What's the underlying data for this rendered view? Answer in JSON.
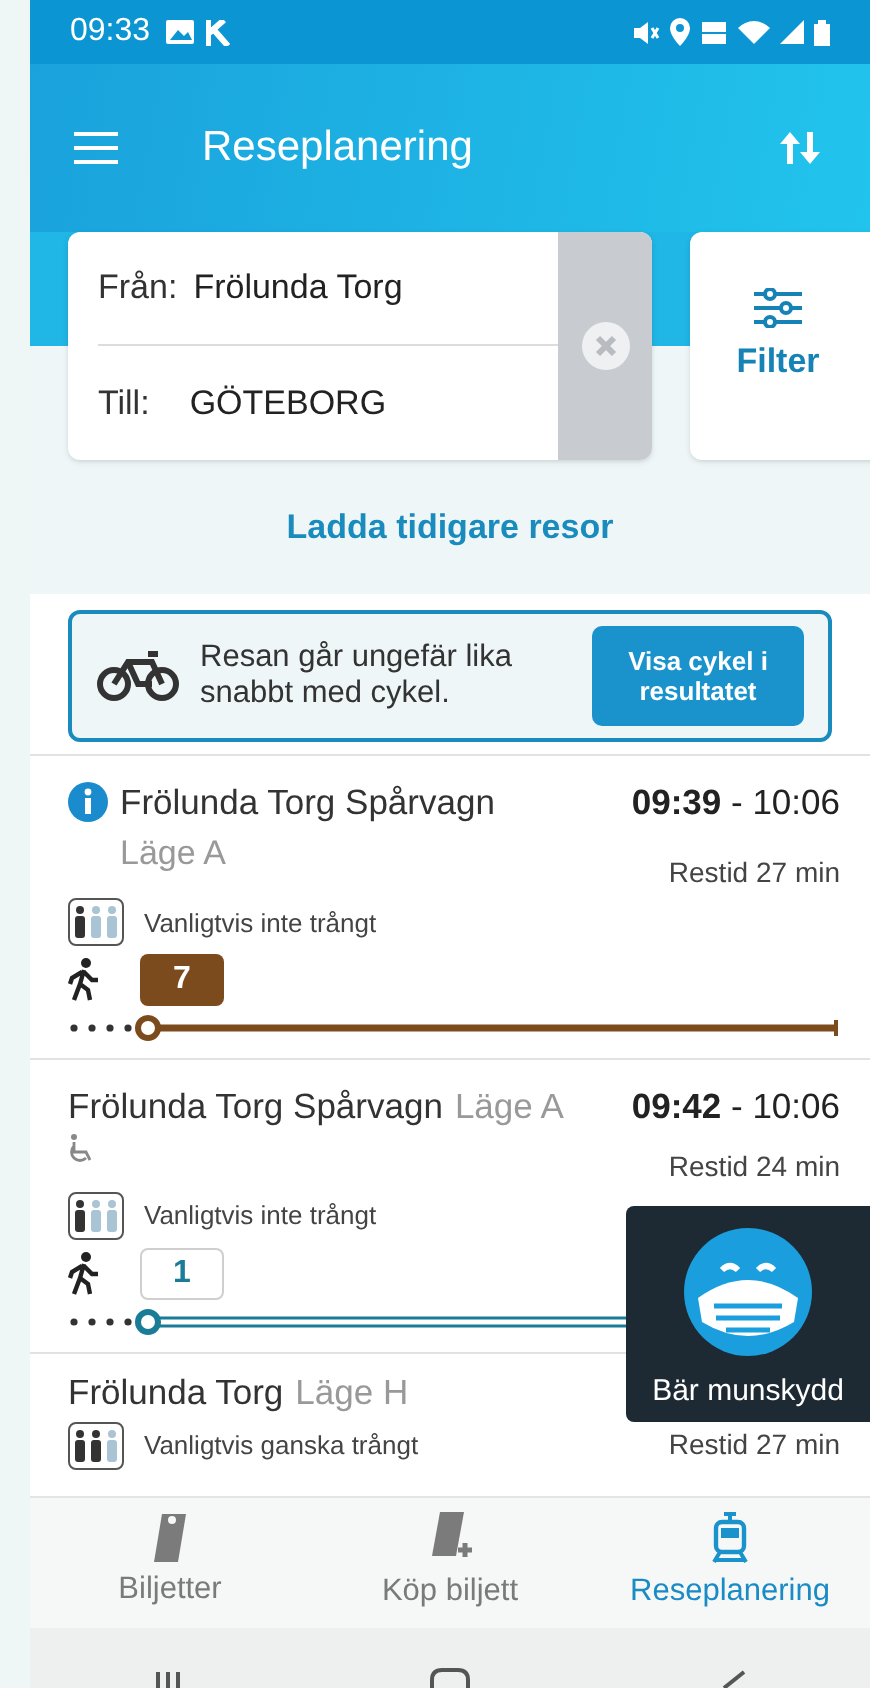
{
  "status_bar": {
    "time": "09:33"
  },
  "app_bar": {
    "title": "Reseplanering"
  },
  "search": {
    "from_label": "Från:",
    "from_value": "Frölunda Torg",
    "to_label": "Till:",
    "to_value": "GÖTEBORG",
    "filter_label": "Filter"
  },
  "load_earlier": "Ladda tidigare resor",
  "bike_banner": {
    "text": "Resan går ungefär lika snabbt med cykel.",
    "button": "Visa cykel i resultatet"
  },
  "trips": [
    {
      "stop": "Frölunda Torg Spårvagn",
      "position": "Läge A",
      "position_inline": false,
      "info": true,
      "accessible": false,
      "time": "**09:39** - 10:06",
      "duration": "Restid 27 min",
      "crowding": [
        {
          "filled": true
        },
        {
          "filled": false
        },
        {
          "filled": false
        }
      ],
      "crowding_text": "Vanligtvis inte trångt",
      "line": {
        "number": "7",
        "kind": "filled",
        "color": "#7b4a1d"
      }
    },
    {
      "stop": "Frölunda Torg Spårvagn",
      "position": "Läge A",
      "position_inline": true,
      "info": false,
      "accessible": true,
      "time": "**09:42** - 10:06",
      "duration": "Restid 24 min",
      "crowding": [
        {
          "filled": true
        },
        {
          "filled": false
        },
        {
          "filled": false
        }
      ],
      "crowding_text": "Vanligtvis inte trångt",
      "line": {
        "number": "1",
        "kind": "outlined",
        "color": "#1b7c97"
      }
    },
    {
      "stop": "Frölunda Torg",
      "position": "Läge H",
      "position_inline": true,
      "info": false,
      "accessible": false,
      "duration": "Restid 27 min",
      "crowding": [
        {
          "filled": true
        },
        {
          "filled": true
        },
        {
          "filled": false
        }
      ],
      "crowding_text": "Vanligtvis ganska trångt"
    }
  ],
  "tooltip": {
    "text": "Bär munskydd"
  },
  "bottom_nav": [
    {
      "label": "Biljetter",
      "selected": false
    },
    {
      "label": "Köp biljett",
      "selected": false
    },
    {
      "label": "Reseplanering",
      "selected": true
    }
  ]
}
